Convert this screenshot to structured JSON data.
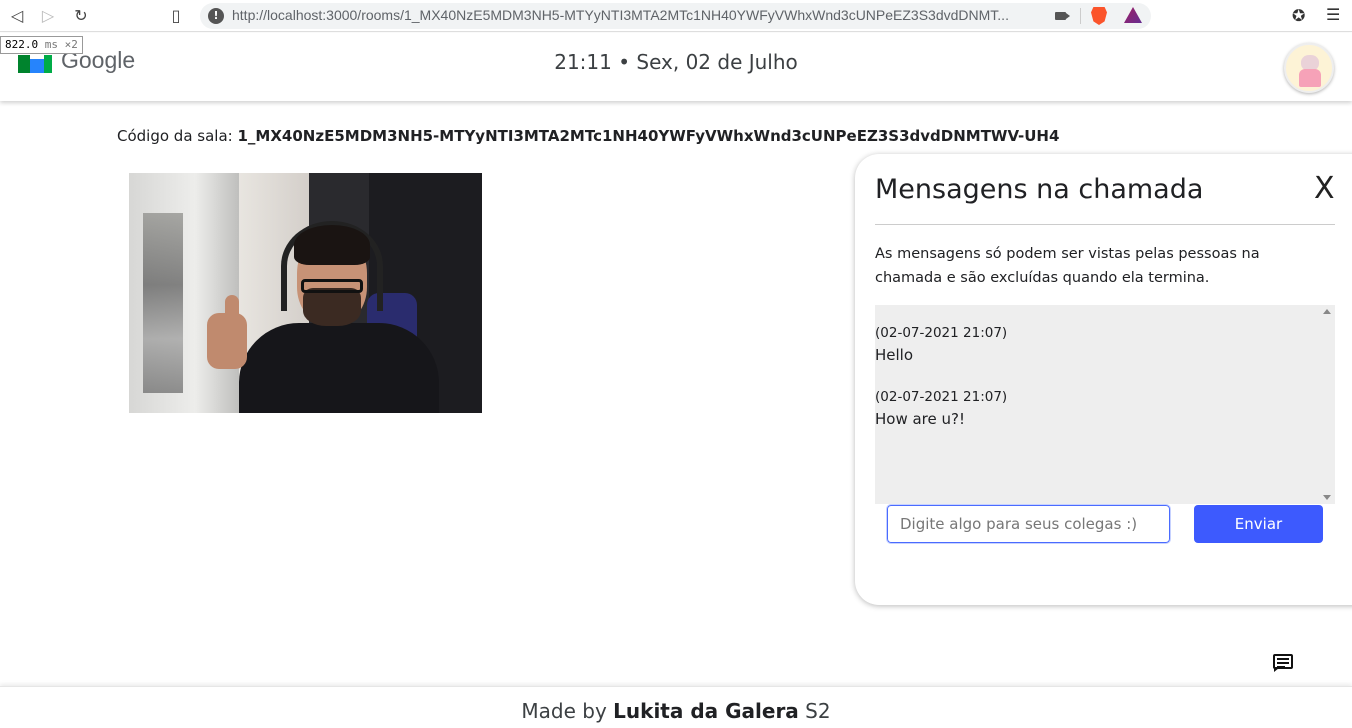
{
  "browser": {
    "url": "http://localhost:3000/rooms/1_MX40NzE5MDM3NH5-MTYyNTI3MTA2MTc1NH40YWFyVWhxWnd3cUNPeEZ3S3dvdDNMT...",
    "icons": [
      "back-arrow-icon",
      "forward-arrow-icon",
      "reload-icon",
      "bookmark-icon",
      "site-info-icon",
      "camera-icon",
      "brave-shields-icon",
      "brave-rewards-icon",
      "extensions-icon",
      "menu-icon"
    ]
  },
  "timing": {
    "value": "822.0",
    "unit": "ms",
    "multiplier": "×2"
  },
  "header": {
    "logo_text": "Google",
    "clock": "21:11 • Sex, 02 de Julho",
    "avatar": "user-avatar"
  },
  "room": {
    "label": "Código da sala:",
    "code": "1_MX40NzE5MDM3NH5-MTYyNTI3MTA2MTc1NH40YWFyVWhxWnd3cUNPeEZ3S3dvdDNMTWV-UH4"
  },
  "chat": {
    "title": "Mensagens na chamada",
    "close": "X",
    "notice": "As mensagens só podem ser vistas pelas pessoas na chamada e são excluídas quando ela termina.",
    "messages": [
      {
        "time": "(02-07-2021 21:07)",
        "text": "Hello"
      },
      {
        "time": "(02-07-2021 21:07)",
        "text": "How are u?!"
      }
    ],
    "input_placeholder": "Digite algo para seus colegas :)",
    "input_value": "",
    "send_label": "Enviar"
  },
  "footer": {
    "prefix": "Made by",
    "author": "Lukita da Galera",
    "suffix": "S2"
  },
  "colors": {
    "accent": "#3d5afe",
    "chat_log_bg": "#eeeeee"
  }
}
